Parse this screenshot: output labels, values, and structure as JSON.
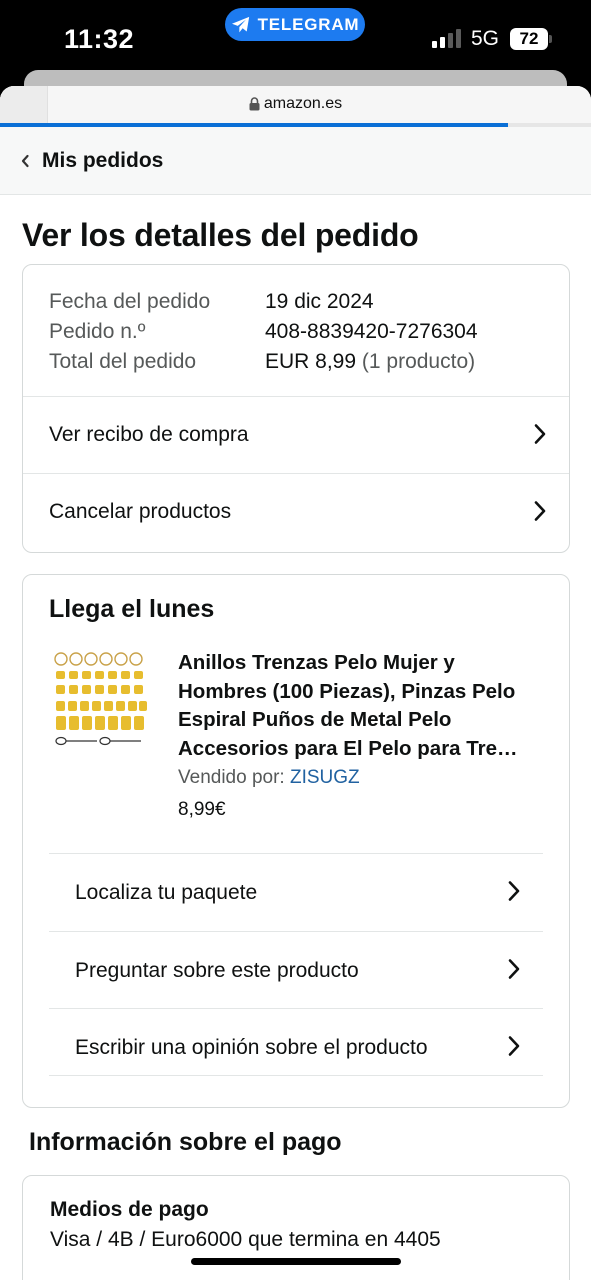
{
  "status_bar": {
    "time": "11:32",
    "app_pill": "TELEGRAM",
    "network": "5G",
    "battery": "72",
    "signal_bars_active": 2,
    "signal_bars_total": 4
  },
  "browser": {
    "url": "amazon.es",
    "load_progress": 0.86,
    "accent": "#0a6fd6"
  },
  "nav": {
    "back_label": "Mis pedidos"
  },
  "page": {
    "title": "Ver los detalles del pedido"
  },
  "order_summary": {
    "date_label": "Fecha del pedido",
    "date_value": "19 dic 2024",
    "number_label": "Pedido n.º",
    "number_value": "408-8839420-7276304",
    "total_label": "Total del pedido",
    "total_value": "EUR 8,99",
    "total_count": "(1 producto)",
    "links": [
      "Ver recibo de compra",
      "Cancelar productos"
    ]
  },
  "delivery": {
    "heading": "Llega el lunes",
    "product_title": "Anillos Trenzas Pelo Mujer y Hombres (100 Piezas), Pinzas Pelo Espiral Puños de Metal Pelo Accesorios para El Pelo para Tre…",
    "sold_by_label": "Vendido por:",
    "seller": "ZISUGZ",
    "price": "8,99€",
    "actions": [
      "Localiza tu paquete",
      "Preguntar sobre este producto",
      "Escribir una opinión sobre el producto"
    ]
  },
  "payment": {
    "section_title": "Información sobre el pago",
    "methods_label": "Medios de pago",
    "methods_value": "Visa / 4B / Euro6000  que termina en 4405"
  },
  "colors": {
    "link_blue": "#2162a1",
    "telegram_blue": "#1d7bf0",
    "border": "#d5d9d9",
    "muted_text": "#565959"
  }
}
